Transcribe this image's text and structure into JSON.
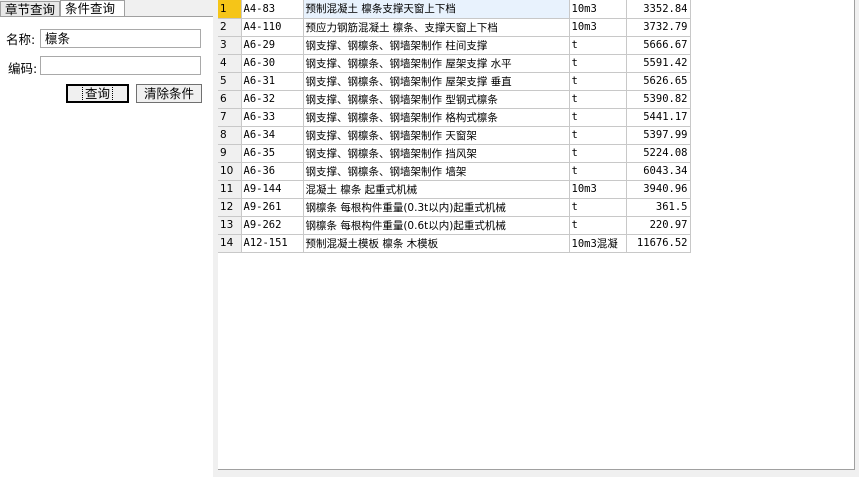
{
  "tabs": {
    "chapter_label": "章节查询",
    "condition_label": "条件查询"
  },
  "search": {
    "name_label": "名称:",
    "name_value": "檩条",
    "code_label": "编码:",
    "code_value": "",
    "query_button": "查询",
    "clear_button": "清除条件"
  },
  "rows": [
    {
      "n": "1",
      "code": "A4-83",
      "name": "预制混凝土 檩条支撑天窗上下档",
      "unit": "10m3",
      "price": "3352.84"
    },
    {
      "n": "2",
      "code": "A4-110",
      "name": "预应力钢筋混凝土 檩条、支撑天窗上下档",
      "unit": "10m3",
      "price": "3732.79"
    },
    {
      "n": "3",
      "code": "A6-29",
      "name": "钢支撑、钢檩条、钢墙架制作 柱间支撑",
      "unit": "t",
      "price": "5666.67"
    },
    {
      "n": "4",
      "code": "A6-30",
      "name": "钢支撑、钢檩条、钢墙架制作 屋架支撑 水平",
      "unit": "t",
      "price": "5591.42"
    },
    {
      "n": "5",
      "code": "A6-31",
      "name": "钢支撑、钢檩条、钢墙架制作 屋架支撑 垂直",
      "unit": "t",
      "price": "5626.65"
    },
    {
      "n": "6",
      "code": "A6-32",
      "name": "钢支撑、钢檩条、钢墙架制作 型钢式檩条",
      "unit": "t",
      "price": "5390.82"
    },
    {
      "n": "7",
      "code": "A6-33",
      "name": "钢支撑、钢檩条、钢墙架制作 格构式檩条",
      "unit": "t",
      "price": "5441.17"
    },
    {
      "n": "8",
      "code": "A6-34",
      "name": "钢支撑、钢檩条、钢墙架制作 天窗架",
      "unit": "t",
      "price": "5397.99"
    },
    {
      "n": "9",
      "code": "A6-35",
      "name": "钢支撑、钢檩条、钢墙架制作 挡风架",
      "unit": "t",
      "price": "5224.08"
    },
    {
      "n": "10",
      "code": "A6-36",
      "name": "钢支撑、钢檩条、钢墙架制作 墙架",
      "unit": "t",
      "price": "6043.34"
    },
    {
      "n": "11",
      "code": "A9-144",
      "name": "混凝土 檩条 起重式机械",
      "unit": "10m3",
      "price": "3940.96"
    },
    {
      "n": "12",
      "code": "A9-261",
      "name": "钢檩条 每根构件重量(0.3t以内)起重式机械",
      "unit": "t",
      "price": "361.5"
    },
    {
      "n": "13",
      "code": "A9-262",
      "name": "钢檩条 每根构件重量(0.6t以内)起重式机械",
      "unit": "t",
      "price": "220.97"
    },
    {
      "n": "14",
      "code": "A12-151",
      "name": "预制混凝土模板 檩条 木模板",
      "unit": "10m3混凝",
      "price": "11676.52"
    }
  ]
}
